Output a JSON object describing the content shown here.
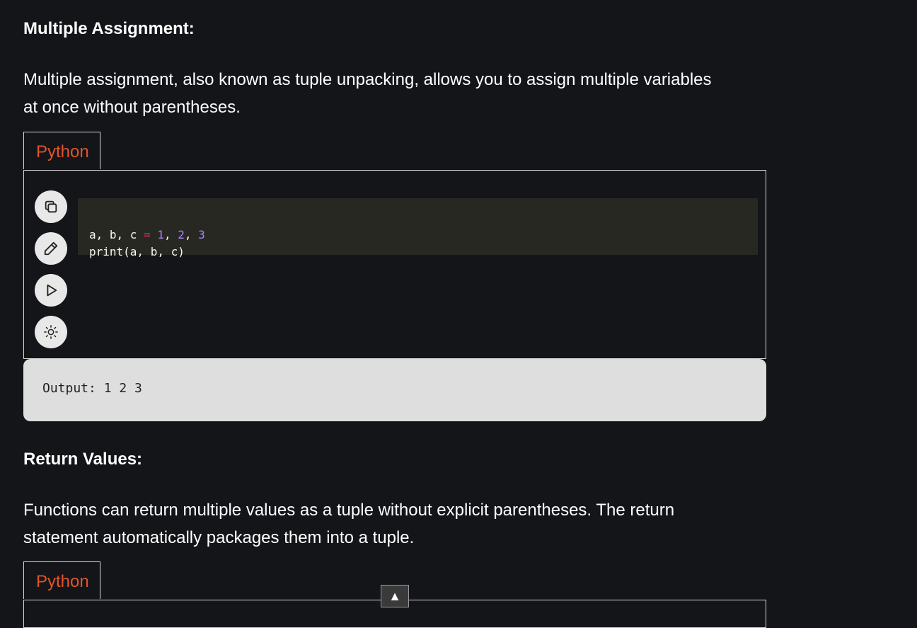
{
  "section1": {
    "heading": "Multiple Assignment:",
    "paragraph_line1": "Multiple assignment, also known as tuple unpacking, allows you to assign multiple variables",
    "paragraph_line2": "at once without parentheses.",
    "tab_label": "Python",
    "code": {
      "line1": {
        "a": "a, b, c ",
        "eq": "=",
        "v1": " 1",
        "c1": ", ",
        "v2": "2",
        "c2": ", ",
        "v3": "3"
      },
      "line2": "print(a, b, c)"
    },
    "output": "Output: 1 2 3"
  },
  "toolbar": {
    "icons": [
      "copy-icon",
      "edit-icon",
      "run-icon",
      "theme-icon"
    ]
  },
  "section2": {
    "heading": "Return Values:",
    "paragraph_line1": "Functions can return multiple values as a tuple without explicit parentheses. The return",
    "paragraph_line2": "statement automatically packages them into a tuple.",
    "tab_label": "Python"
  },
  "scroll_top_label": "▲",
  "colors": {
    "background": "#141519",
    "tab_text": "#e0542a",
    "code_bg": "#272822",
    "output_bg": "#dedede"
  }
}
